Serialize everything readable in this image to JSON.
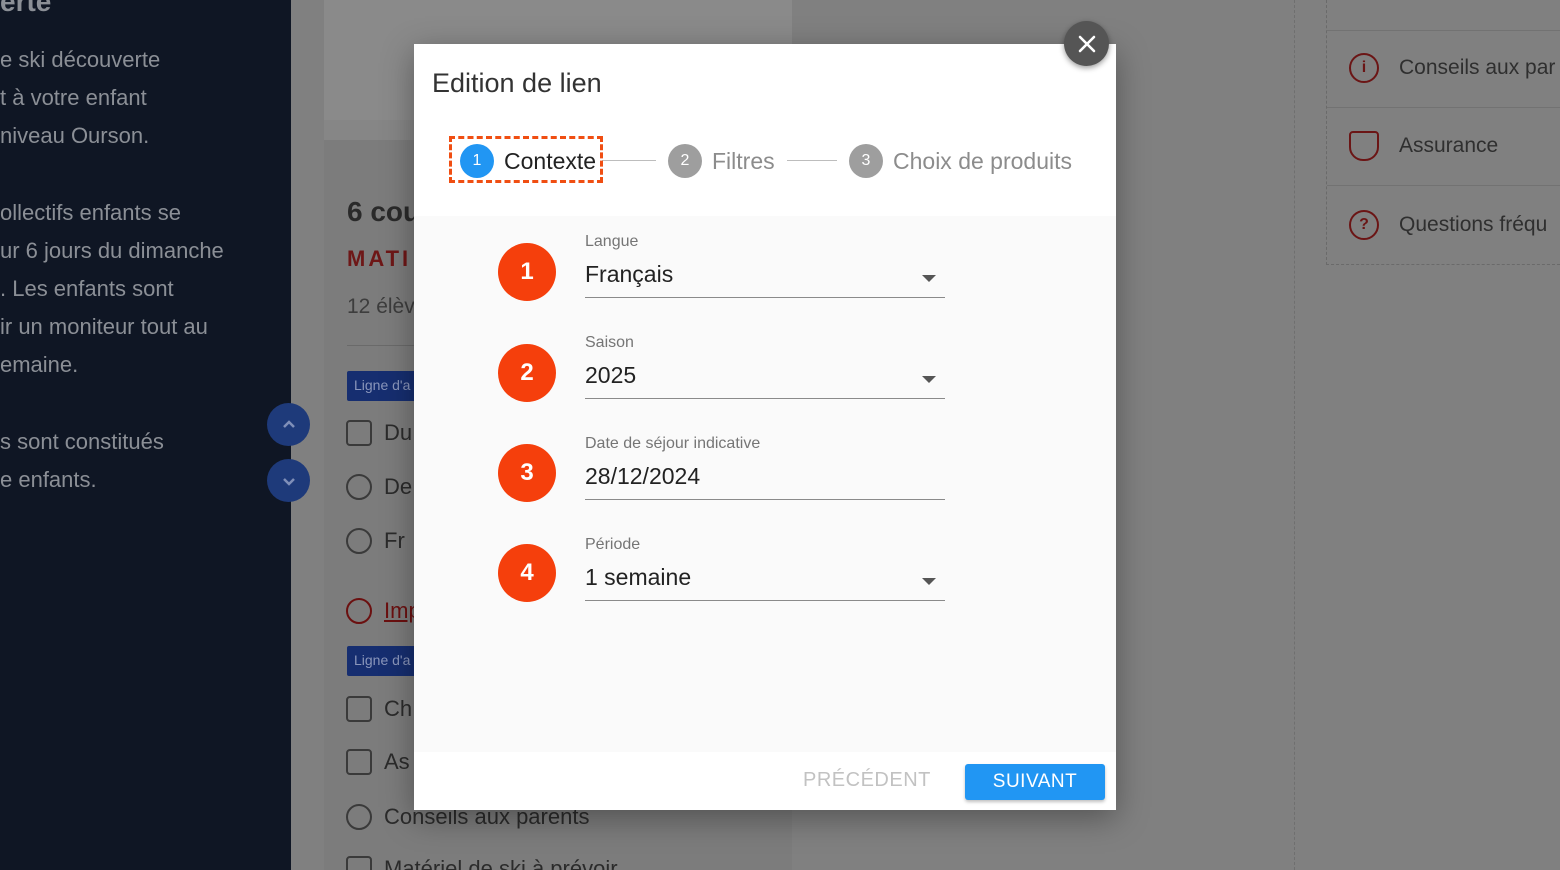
{
  "background": {
    "left_panel": {
      "title": "erte",
      "lines": [
        "e ski découverte",
        "t à votre enfant",
        "niveau Ourson.",
        "",
        "ollectifs enfants se",
        "ur 6 jours du dimanche",
        ". Les enfants sont",
        "ir un moniteur tout au",
        "emaine.",
        "",
        "s sont constitués",
        "e enfants."
      ]
    },
    "card": {
      "heading": "6 cou",
      "subheading": "MATI",
      "small_text": "12 élèv",
      "tag1": "Ligne d'a",
      "row_du": "Du",
      "row_de": "De",
      "row_fr": "Fr",
      "important_link": "Imp",
      "tag2": "Ligne d'a",
      "row_ch": "Ch",
      "row_as": "As",
      "row_conseils": "Conseils aux parents",
      "row_materiel": "Matériel de ski à prévoir"
    },
    "right_list": {
      "items": [
        "Conseils aux par",
        "Assurance",
        "Questions fréqu"
      ]
    }
  },
  "modal": {
    "title": "Edition de lien",
    "steps": [
      {
        "num": "1",
        "label": "Contexte"
      },
      {
        "num": "2",
        "label": "Filtres"
      },
      {
        "num": "3",
        "label": "Choix de produits"
      }
    ],
    "fields": {
      "langue": {
        "label": "Langue",
        "value": "Français"
      },
      "saison": {
        "label": "Saison",
        "value": "2025"
      },
      "date": {
        "label": "Date de séjour indicative",
        "value": "28/12/2024"
      },
      "periode": {
        "label": "Période",
        "value": "1 semaine"
      }
    },
    "badges": [
      "1",
      "2",
      "3",
      "4"
    ],
    "buttons": {
      "prev": "PRÉCÉDENT",
      "next": "SUIVANT"
    }
  },
  "colors": {
    "accent": "#2196f3",
    "highlight": "#f04e12",
    "badge": "#f53f0c"
  }
}
